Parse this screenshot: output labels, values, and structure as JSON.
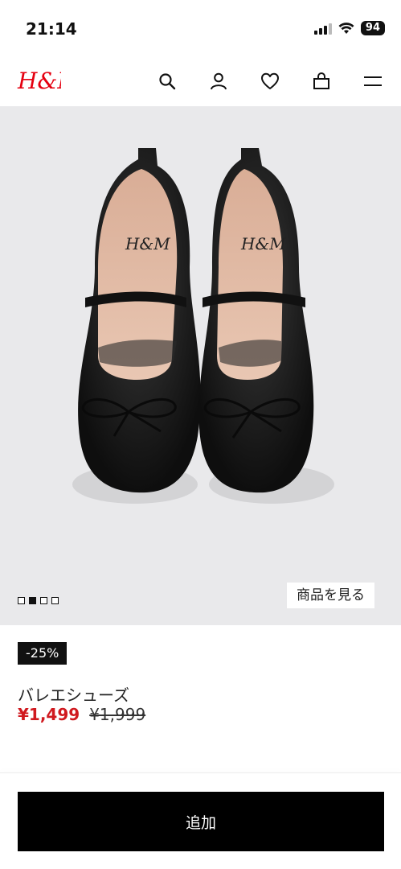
{
  "status_bar": {
    "time": "21:14",
    "battery": "94"
  },
  "header": {
    "logo_text": "H&M",
    "icons": [
      "search-icon",
      "account-icon",
      "favorite-heart-icon",
      "shopping-bag-icon",
      "menu-icon"
    ]
  },
  "hero": {
    "view_product_label": "商品を見る",
    "carousel": {
      "count": 4,
      "active_index": 1
    }
  },
  "product": {
    "discount_badge": "-25%",
    "name": "バレエシューズ",
    "sale_price": "¥1,499",
    "original_price": "¥1,999"
  },
  "actions": {
    "add_label": "追加"
  },
  "colors": {
    "sale_red": "#d0191f",
    "brand_red": "#e50010",
    "image_bg": "#e9e9eb"
  }
}
